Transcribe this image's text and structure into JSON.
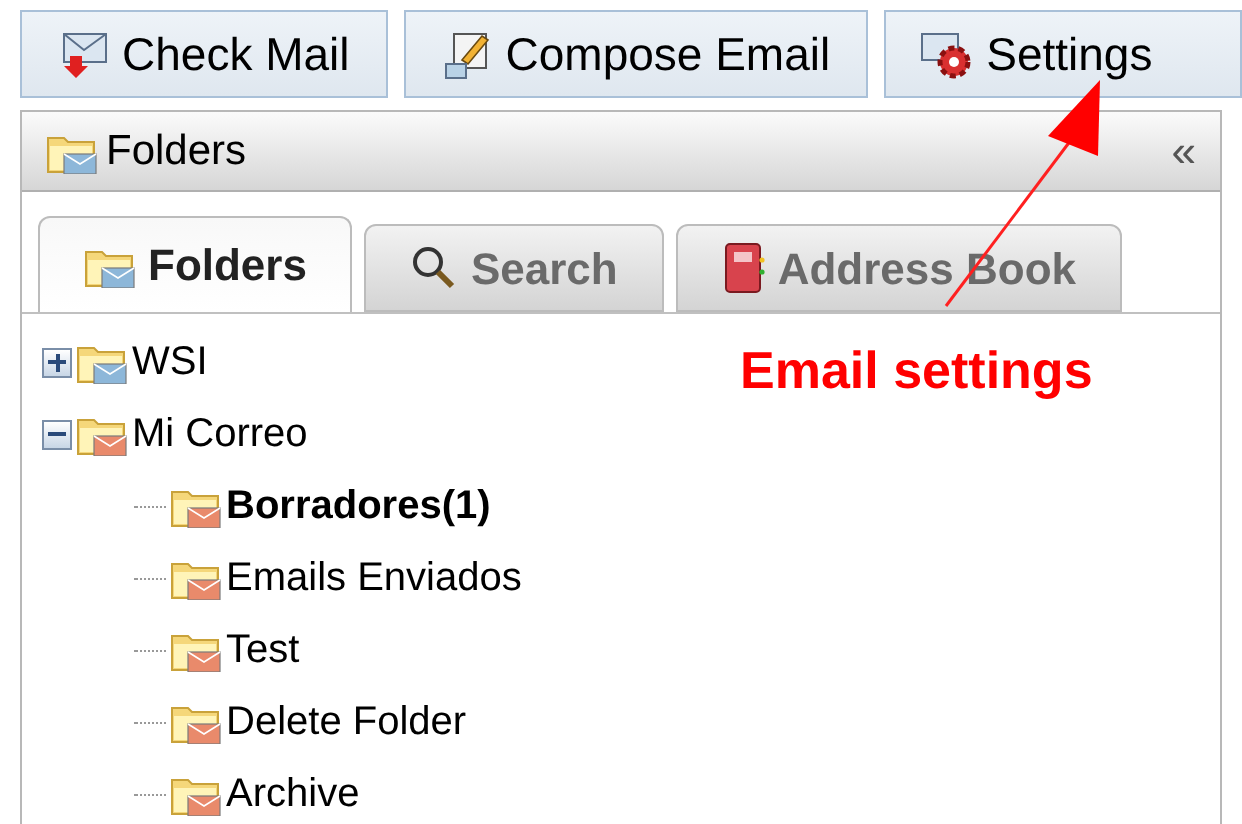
{
  "toolbar": [
    {
      "label": "Check Mail",
      "kind": "check"
    },
    {
      "label": "Compose Email",
      "kind": "compose"
    },
    {
      "label": "Settings",
      "kind": "settings"
    }
  ],
  "panel": {
    "title": "Folders",
    "collapse": "«"
  },
  "tabs": [
    {
      "label": "Folders",
      "kind": "folders",
      "selected": true
    },
    {
      "label": "Search",
      "kind": "search",
      "selected": false
    },
    {
      "label": "Address Book",
      "kind": "book",
      "selected": false
    }
  ],
  "tree": [
    {
      "label": "WSI",
      "color": "#8db7d9",
      "expanded": false,
      "unread": false
    },
    {
      "label": "Mi Correo",
      "color": "#e98a6b",
      "expanded": true,
      "unread": false,
      "children": [
        {
          "label": "Borradores(1)",
          "color": "#e98a6b",
          "unread": true
        },
        {
          "label": "Emails Enviados",
          "color": "#e98a6b",
          "unread": false
        },
        {
          "label": "Test",
          "color": "#e98a6b",
          "unread": false
        },
        {
          "label": "Delete Folder",
          "color": "#e98a6b",
          "unread": false
        },
        {
          "label": "Archive",
          "color": "#e98a6b",
          "unread": false
        }
      ]
    }
  ],
  "annotation": {
    "label": "Email settings"
  }
}
